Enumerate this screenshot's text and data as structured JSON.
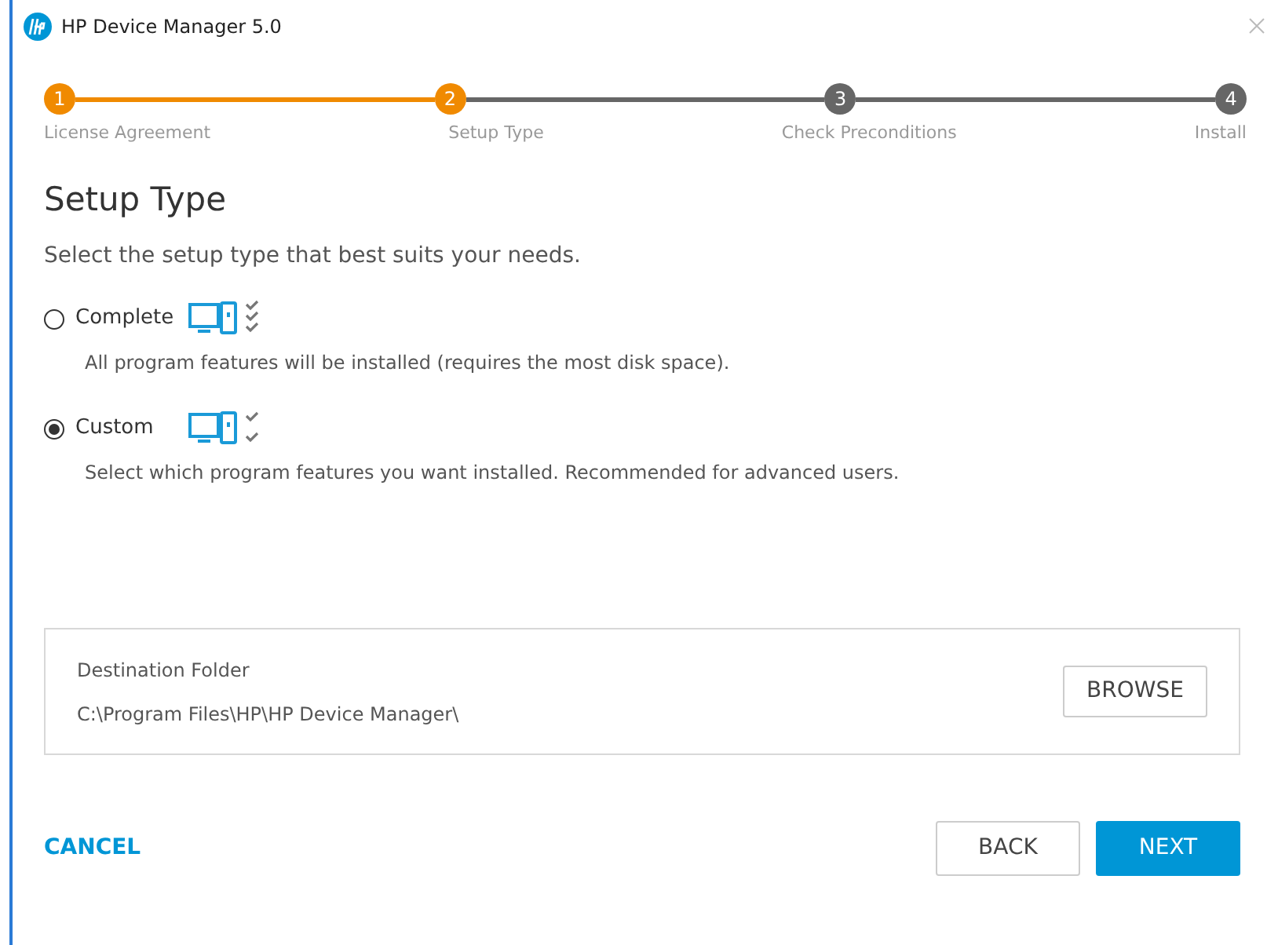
{
  "window": {
    "title": "HP Device Manager 5.0"
  },
  "steps": [
    {
      "number": "1",
      "label": "License Agreement",
      "active": true
    },
    {
      "number": "2",
      "label": "Setup Type",
      "active": true
    },
    {
      "number": "3",
      "label": "Check Preconditions",
      "active": false
    },
    {
      "number": "4",
      "label": "Install",
      "active": false
    }
  ],
  "heading": "Setup Type",
  "subtitle": "Select the setup type that best suits your needs.",
  "options": [
    {
      "kind": "complete",
      "label": "Complete",
      "description": "All program features will be installed (requires the most disk space).",
      "selected": false
    },
    {
      "kind": "custom",
      "label": "Custom",
      "description": "Select which program features you want installed. Recommended for advanced users.",
      "selected": true
    }
  ],
  "destination": {
    "label": "Destination Folder",
    "path": "C:\\Program Files\\HP\\HP Device Manager\\",
    "button": "BROWSE"
  },
  "footer": {
    "cancel": "CANCEL",
    "back": "BACK",
    "next": "NEXT"
  }
}
